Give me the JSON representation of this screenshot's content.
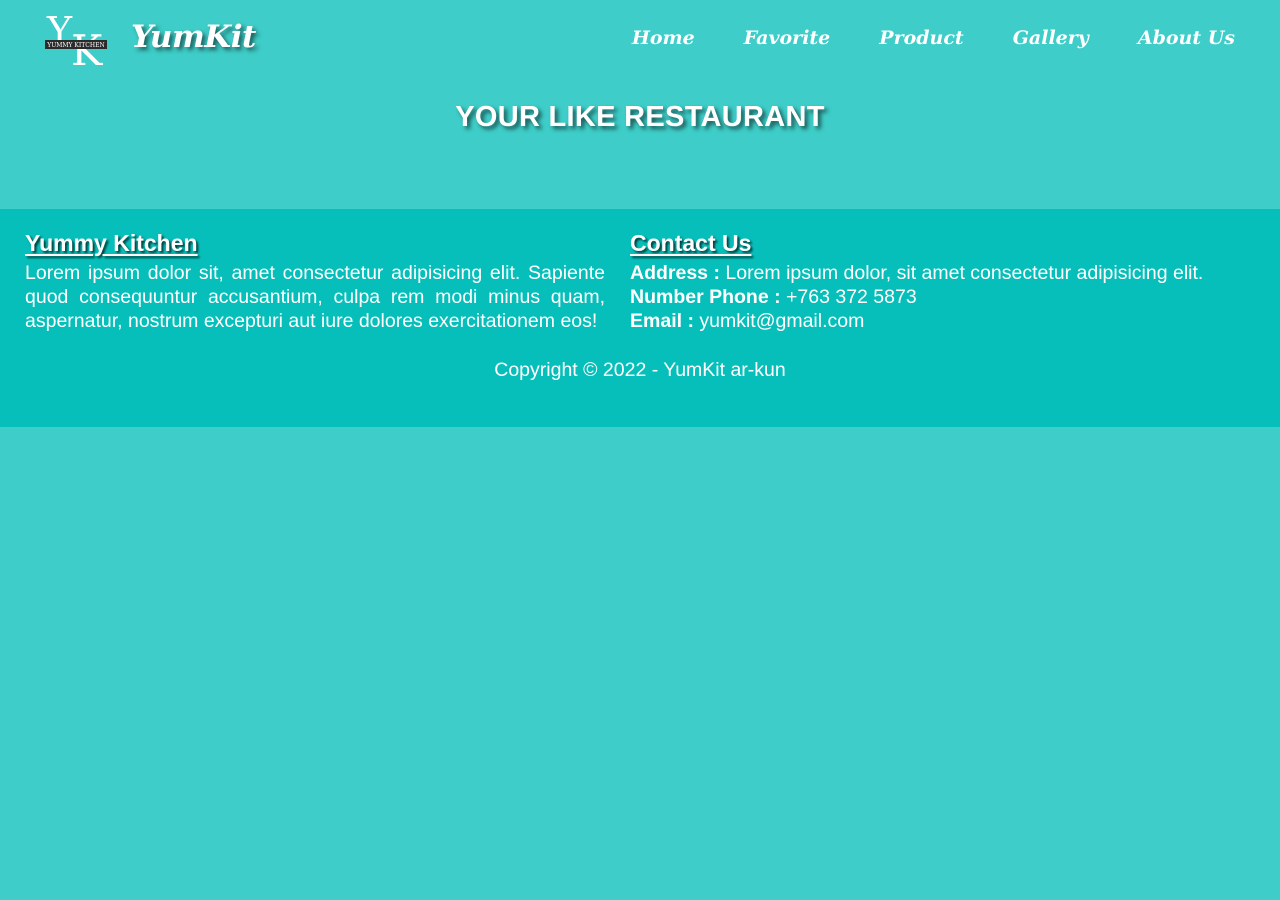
{
  "header": {
    "logo_text": "YUMMY KITCHEN",
    "brand": "YumKit",
    "nav": [
      {
        "label": "Home"
      },
      {
        "label": "Favorite"
      },
      {
        "label": "Product"
      },
      {
        "label": "Gallery"
      },
      {
        "label": "About Us"
      }
    ]
  },
  "hero": {
    "title": "YOUR LIKE RESTAURANT"
  },
  "footer": {
    "about": {
      "heading": "Yummy Kitchen",
      "text": "Lorem ipsum dolor sit, amet consectetur adipisicing elit. Sapiente quod consequuntur accusantium, culpa rem modi minus quam, aspernatur, nostrum excepturi aut iure dolores exercitationem eos!"
    },
    "contact": {
      "heading": "Contact Us",
      "address_label": "Address :",
      "address_value": "Lorem ipsum dolor, sit amet consectetur adipisicing elit.",
      "phone_label": "Number Phone :",
      "phone_value": "+763 372 5873",
      "email_label": "Email :",
      "email_value": "yumkit@gmail.com"
    },
    "copyright": "Copyright © 2022 - YumKit ar-kun"
  },
  "colors": {
    "background": "#3ecdc8",
    "footer_background": "#07bfba",
    "text": "#ffffff"
  }
}
